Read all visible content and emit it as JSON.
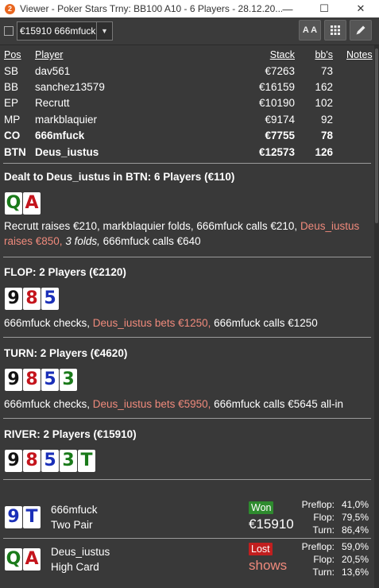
{
  "window": {
    "title": "Viewer - Poker Stars Trny: BB100 A10 - 6 Players - 28.12.20...",
    "app_icon_glyph": "2",
    "controls": {
      "minimize": "—",
      "maximize": "☐",
      "close": "✕"
    }
  },
  "toolbar": {
    "combo_value": "€15910 666mfuck",
    "btn_font": "A A",
    "btn_grid": "grid-icon",
    "btn_edit": "pencil-icon"
  },
  "players": {
    "headers": {
      "pos": "Pos",
      "player": "Player",
      "stack": "Stack",
      "bbs": "bb's",
      "notes": "Notes"
    },
    "rows": [
      {
        "pos": "SB",
        "player": "dav561",
        "stack": "€7263",
        "bbs": "73",
        "bold": false
      },
      {
        "pos": "BB",
        "player": "sanchez13579",
        "stack": "€16159",
        "bbs": "162",
        "bold": false
      },
      {
        "pos": "EP",
        "player": "Recrutt",
        "stack": "€10190",
        "bbs": "102",
        "bold": false
      },
      {
        "pos": "MP",
        "player": "markblaquier",
        "stack": "€9174",
        "bbs": "92",
        "bold": false
      },
      {
        "pos": "CO",
        "player": "666mfuck",
        "stack": "€7755",
        "bbs": "78",
        "bold": true
      },
      {
        "pos": "BTN",
        "player": "Deus_iustus",
        "stack": "€12573",
        "bbs": "126",
        "bold": true
      }
    ]
  },
  "preflop": {
    "title": "Dealt to Deus_iustus in BTN: 6 Players (€110)",
    "cards": [
      {
        "rank": "Q",
        "suit": "cl"
      },
      {
        "rank": "A",
        "suit": "h"
      }
    ],
    "a1": "Recrutt raises €210, markblaquier folds, 666mfuck calls €210, ",
    "a2": "Deus_iustus raises €850,",
    "a3": "3 folds,",
    "a4": " 666mfuck calls €640"
  },
  "flop": {
    "title": "FLOP: 2 Players (€2120)",
    "cards": [
      {
        "rank": "9",
        "suit": "s"
      },
      {
        "rank": "8",
        "suit": "h"
      },
      {
        "rank": "5",
        "suit": "d"
      }
    ],
    "a1": "666mfuck checks, ",
    "a2": "Deus_iustus bets €1250,",
    "a3": " 666mfuck calls €1250"
  },
  "turn": {
    "title": "TURN: 2 Players (€4620)",
    "cards": [
      {
        "rank": "9",
        "suit": "s"
      },
      {
        "rank": "8",
        "suit": "h"
      },
      {
        "rank": "5",
        "suit": "d"
      },
      {
        "rank": "3",
        "suit": "cl"
      }
    ],
    "a1": "666mfuck checks, ",
    "a2": "Deus_iustus bets €5950,",
    "a3": " 666mfuck calls €5645 all-in"
  },
  "river": {
    "title": "RIVER: 2 Players (€15910)",
    "cards": [
      {
        "rank": "9",
        "suit": "s"
      },
      {
        "rank": "8",
        "suit": "h"
      },
      {
        "rank": "5",
        "suit": "d"
      },
      {
        "rank": "3",
        "suit": "cl"
      },
      {
        "rank": "T",
        "suit": "cl"
      }
    ]
  },
  "results": [
    {
      "player": "666mfuck",
      "hand": "Two Pair",
      "cards": [
        {
          "rank": "9",
          "suit": "d"
        },
        {
          "rank": "T",
          "suit": "d"
        }
      ],
      "badge": "Won",
      "amount": "€15910",
      "stats": [
        {
          "label": "Preflop:",
          "value": "41,0%"
        },
        {
          "label": "Flop:",
          "value": "79,5%"
        },
        {
          "label": "Turn:",
          "value": "86,4%"
        }
      ]
    },
    {
      "player": "Deus_iustus",
      "hand": "High Card",
      "cards": [
        {
          "rank": "Q",
          "suit": "cl"
        },
        {
          "rank": "A",
          "suit": "h"
        }
      ],
      "badge": "Lost",
      "amount": "shows",
      "stats": [
        {
          "label": "Preflop:",
          "value": "59,0%"
        },
        {
          "label": "Flop:",
          "value": "20,5%"
        },
        {
          "label": "Turn:",
          "value": "13,6%"
        }
      ]
    }
  ],
  "colors": {
    "panel": "#393939",
    "highlight": "#f08a7c",
    "won": "#2e8b2e",
    "lost": "#c11f1f"
  }
}
